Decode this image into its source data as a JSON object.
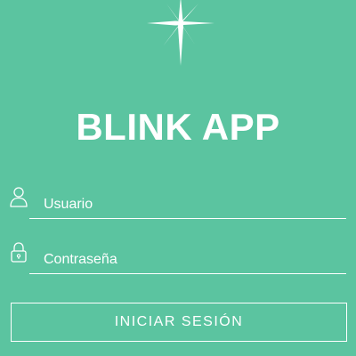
{
  "app": {
    "title": "BLINK APP",
    "logo_icon": "sparkle-star-icon"
  },
  "form": {
    "username": {
      "icon": "user-icon",
      "placeholder": "Usuario",
      "value": ""
    },
    "password": {
      "icon": "lock-icon",
      "placeholder": "Contraseña",
      "value": ""
    },
    "submit_label": "INICIAR SESIÓN"
  },
  "colors": {
    "background": "#5bc4a0",
    "foreground": "#ffffff"
  }
}
